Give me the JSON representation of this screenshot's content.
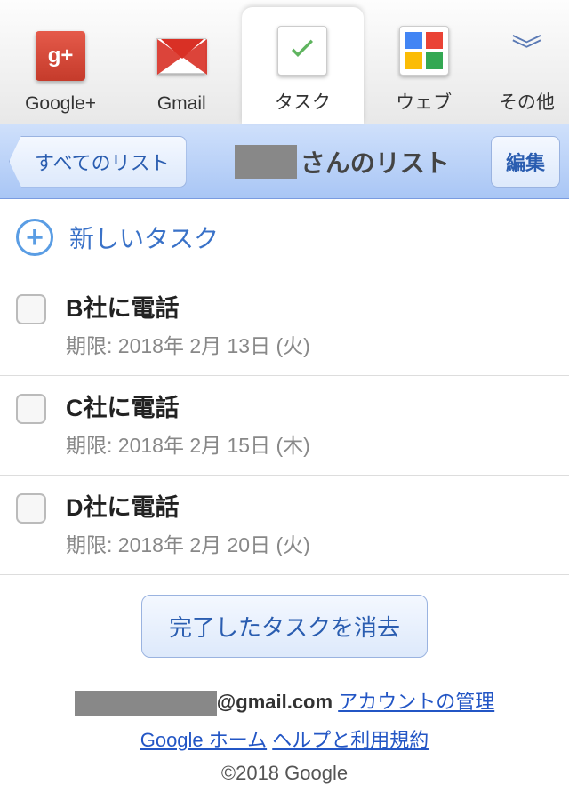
{
  "tabs": [
    {
      "label": "Google+",
      "icon": "gplus"
    },
    {
      "label": "Gmail",
      "icon": "gmail"
    },
    {
      "label": "タスク",
      "icon": "task",
      "active": true
    },
    {
      "label": "ウェブ",
      "icon": "web"
    },
    {
      "label": "その他",
      "icon": "more"
    }
  ],
  "header": {
    "back": "すべてのリスト",
    "title_suffix": "さんのリスト",
    "edit": "編集"
  },
  "new_task": "新しいタスク",
  "tasks": [
    {
      "title": "B社に電話",
      "due": "期限: 2018年 2月 13日 (火)"
    },
    {
      "title": "C社に電話",
      "due": "期限: 2018年 2月 15日 (木)"
    },
    {
      "title": "D社に電話",
      "due": "期限: 2018年 2月 20日 (火)"
    }
  ],
  "clear_completed": "完了したタスクを消去",
  "footer": {
    "email_suffix": "@gmail.com",
    "account_link": "アカウントの管理",
    "home_link": "Google ホーム",
    "help_link": "ヘルプと利用規約",
    "copyright": "©2018 Google"
  }
}
